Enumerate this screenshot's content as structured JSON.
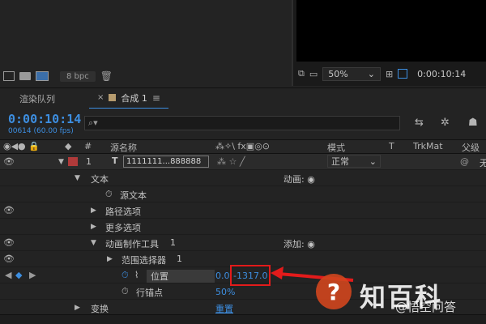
{
  "project_panel": {
    "bpc_label": "8 bpc"
  },
  "viewer": {
    "zoom": "50%",
    "timecode": "0:00:10:14"
  },
  "tabs": {
    "render_queue": "渲染队列",
    "comp_name": "合成 1"
  },
  "timeline": {
    "current_time": "0:00:10:14",
    "frame_info": "00614 (60.00 fps)",
    "search_placeholder": "⌕▾"
  },
  "columns": {
    "number": "#",
    "source_name": "源名称",
    "mode": "模式",
    "t": "T",
    "trkmat": "TrkMat",
    "parent": "父级"
  },
  "layer": {
    "index": "1",
    "type": "T",
    "name": "1111111...888888",
    "mode": "正常",
    "parent_short": "无"
  },
  "properties": [
    {
      "label": "文本",
      "right": "动画:"
    },
    {
      "label": "源文本"
    },
    {
      "label": "路径选项"
    },
    {
      "label": "更多选项"
    },
    {
      "label": "动画制作工具",
      "suffix": "1",
      "right": "添加:"
    },
    {
      "label": "范围选择器",
      "suffix": "1"
    },
    {
      "label": "位置",
      "value_x": "0.0",
      "value_y": "-1317.0"
    },
    {
      "label": "行锚点",
      "value": "50%"
    },
    {
      "label": "变换",
      "value": "重置"
    }
  ],
  "watermark": {
    "main": "知百科",
    "sub": "@悟空问答"
  },
  "colors": {
    "accent": "#3d8ee0",
    "highlight": "#e31b1b",
    "label_red": "#b03a3a"
  }
}
